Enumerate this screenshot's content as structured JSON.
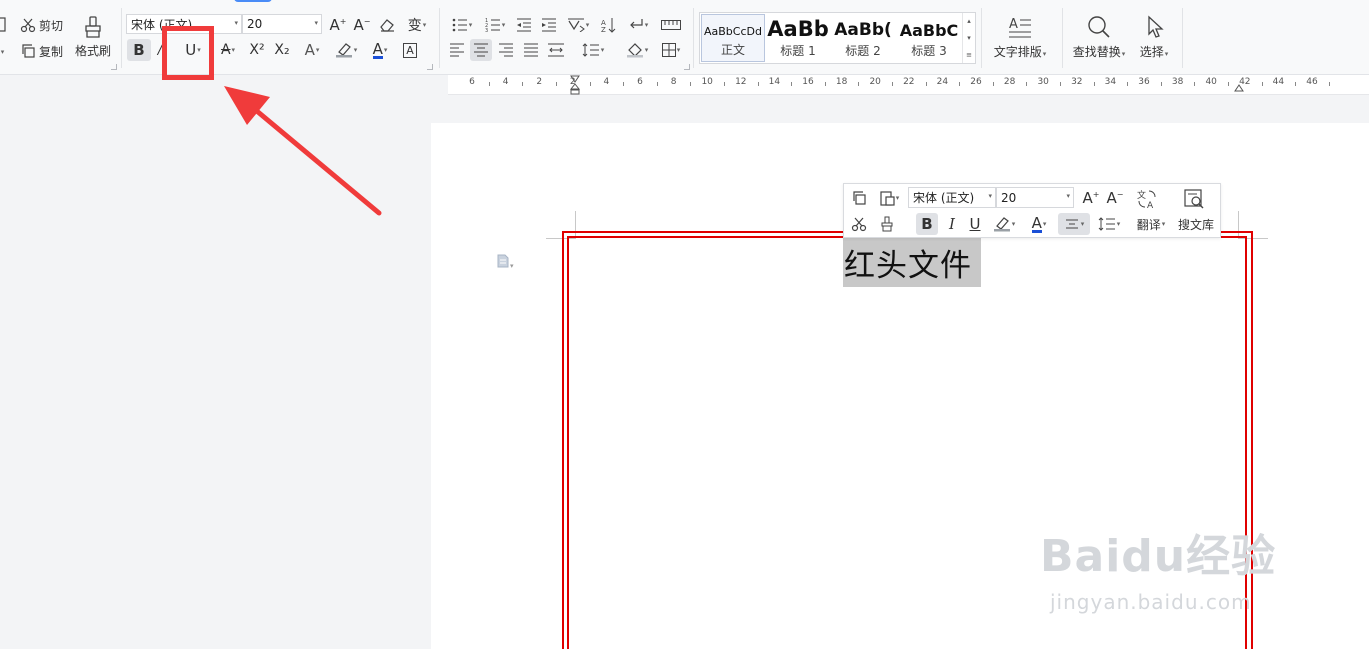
{
  "ribbon": {
    "clipboard": {
      "cut_label": "剪切",
      "copy_label": "复制",
      "format_painter_label": "格式刷"
    },
    "font": {
      "font_name": "宋体 (正文)",
      "font_size": "20",
      "bold_label": "B",
      "underline_label": "U",
      "superscript_label": "X²",
      "subscript_label": "X₂",
      "font_color": "#1a4fd6",
      "pinyin_label": "变"
    },
    "styles": [
      {
        "preview": "AaBbCcDd",
        "name": "正文",
        "selected": true
      },
      {
        "preview": "AaBb",
        "name": "标题 1"
      },
      {
        "preview": "AaBb(",
        "name": "标题 2"
      },
      {
        "preview": "AaBbC",
        "name": "标题 3"
      }
    ],
    "text_layout_label": "文字排版",
    "find_replace_label": "查找替换",
    "select_label": "选择"
  },
  "ruler": {
    "labels": [
      "6",
      "4",
      "2",
      "2",
      "4",
      "6",
      "8",
      "10",
      "12",
      "14",
      "16",
      "18",
      "20",
      "22",
      "24",
      "26",
      "28",
      "30",
      "32",
      "34",
      "36",
      "38",
      "40",
      "42",
      "44",
      "46"
    ]
  },
  "document": {
    "title_text": "红头文件",
    "frame_color": "#e00000"
  },
  "mini_toolbar": {
    "font_name": "宋体 (正文)",
    "font_size": "20",
    "bold_label": "B",
    "italic_label": "I",
    "underline_label": "U",
    "translate_label": "翻译",
    "search_lib_label": "搜文库"
  },
  "watermark": {
    "brand": "Baidu经验",
    "url": "jingyan.baidu.com"
  },
  "annotation": {
    "color": "#f03b3b"
  }
}
